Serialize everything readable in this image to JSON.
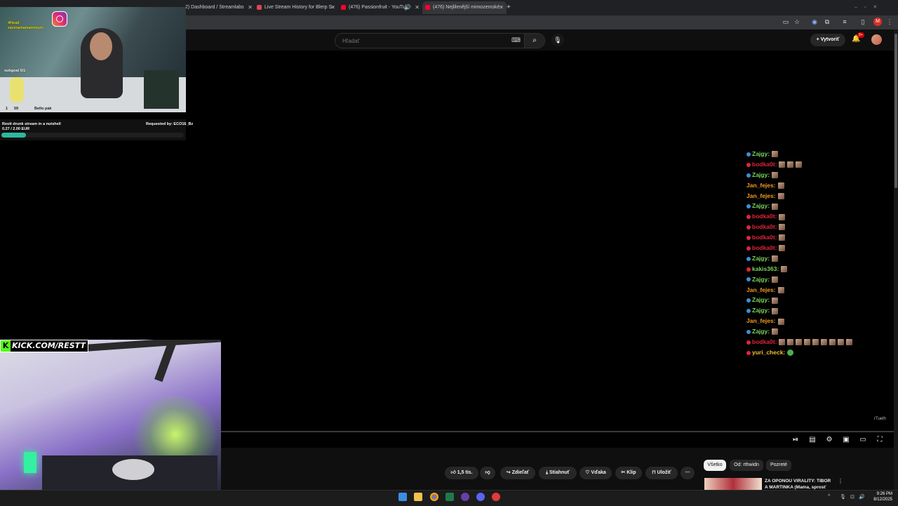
{
  "browser": {
    "tabs": [
      {
        "title": "2) Dashboard / Streamlabs",
        "close": "✕"
      },
      {
        "title": "Live Stream History for Blerp S",
        "close": "✕"
      },
      {
        "title": "(476) Passionfruit - YouTub",
        "close": "✕"
      },
      {
        "title": "(476) Nejlilenější mimozemské",
        "close": "✕"
      }
    ],
    "new_tab": "+",
    "profile_initial": "M"
  },
  "header": {
    "search_placeholder": "Hľadať",
    "create_label": "+ Vytvoriť",
    "notif_count": "9+"
  },
  "stream_overlay": {
    "top_left_text_1": "4Head",
    "top_left_text_2": "zacinamamammum",
    "subgoal_text": "subgoal 0/1",
    "cam_caption_1": "1",
    "cam_caption_2": "59",
    "cam_caption_3": "Bello pak",
    "donation_title": "Restt drunk stream in a nutshell",
    "donation_amount": "0.27 / 2.00 EUR",
    "donation_requested": "Requested by: ECO16_Bz",
    "donation_progress": 0.135,
    "kick_text": "KICK.COM/RESTT"
  },
  "chat": [
    {
      "user": "Zajgy",
      "color": "#7bd45c",
      "badge": "#3a8fd8",
      "emotes": 1
    },
    {
      "user": "bodka0t",
      "color": "#e0263a",
      "badge": "#e0263a",
      "emotes": 3
    },
    {
      "user": "Zajgy",
      "color": "#7bd45c",
      "badge": "#3a8fd8",
      "emotes": 1
    },
    {
      "user": "Jan_fejes",
      "color": "#f39c1f",
      "badge": "",
      "emotes": 1
    },
    {
      "user": "Jan_fejes",
      "color": "#f39c1f",
      "badge": "",
      "emotes": 1
    },
    {
      "user": "Zajgy",
      "color": "#7bd45c",
      "badge": "#3a8fd8",
      "emotes": 1
    },
    {
      "user": "bodka0t",
      "color": "#e0263a",
      "badge": "#e0263a",
      "emotes": 1
    },
    {
      "user": "bodka0t",
      "color": "#e0263a",
      "badge": "#e0263a",
      "emotes": 1
    },
    {
      "user": "bodka0t",
      "color": "#e0263a",
      "badge": "#e0263a",
      "emotes": 1
    },
    {
      "user": "bodka0t",
      "color": "#e0263a",
      "badge": "#e0263a",
      "emotes": 1
    },
    {
      "user": "Zajgy",
      "color": "#7bd45c",
      "badge": "#3a8fd8",
      "emotes": 1
    },
    {
      "user": "kakis363",
      "color": "#7bd45c",
      "badge": "#e0263a",
      "emotes": 1
    },
    {
      "user": "Zajgy",
      "color": "#7bd45c",
      "badge": "#3a8fd8",
      "emotes": 1
    },
    {
      "user": "Jan_fejes",
      "color": "#f39c1f",
      "badge": "",
      "emotes": 1
    },
    {
      "user": "Zajgy",
      "color": "#7bd45c",
      "badge": "#3a8fd8",
      "emotes": 1
    },
    {
      "user": "Zajgy",
      "color": "#7bd45c",
      "badge": "#3a8fd8",
      "emotes": 1
    },
    {
      "user": "Jan_fejes",
      "color": "#f39c1f",
      "badge": "",
      "emotes": 1
    },
    {
      "user": "Zajgy",
      "color": "#7bd45c",
      "badge": "#3a8fd8",
      "emotes": 1
    },
    {
      "user": "bodka0t",
      "color": "#e0263a",
      "badge": "#e0263a",
      "emotes": 9
    },
    {
      "user": "yuri_check",
      "color": "#f1c232",
      "badge": "#e0263a",
      "emotes": 1,
      "green": true
    }
  ],
  "player": {
    "watermark": "rTuelh"
  },
  "actions": {
    "like": "1,5 tis.",
    "share": "Zdieľať",
    "download": "Stiahnuť",
    "thanks": "Vďaka",
    "clip": "Klip",
    "save": "Uložiť",
    "more": "⋯"
  },
  "chips": {
    "all": "Všetko",
    "from": "Od: rthwidn",
    "watched": "Pozreté"
  },
  "recommendation": {
    "title": "ZA OPONOU VIRALITY: TIBOR A MARTINKA (Mama, sprosť ma)"
  },
  "taskbar": {
    "time": "9:26 PM",
    "date": "8/12/2025"
  }
}
